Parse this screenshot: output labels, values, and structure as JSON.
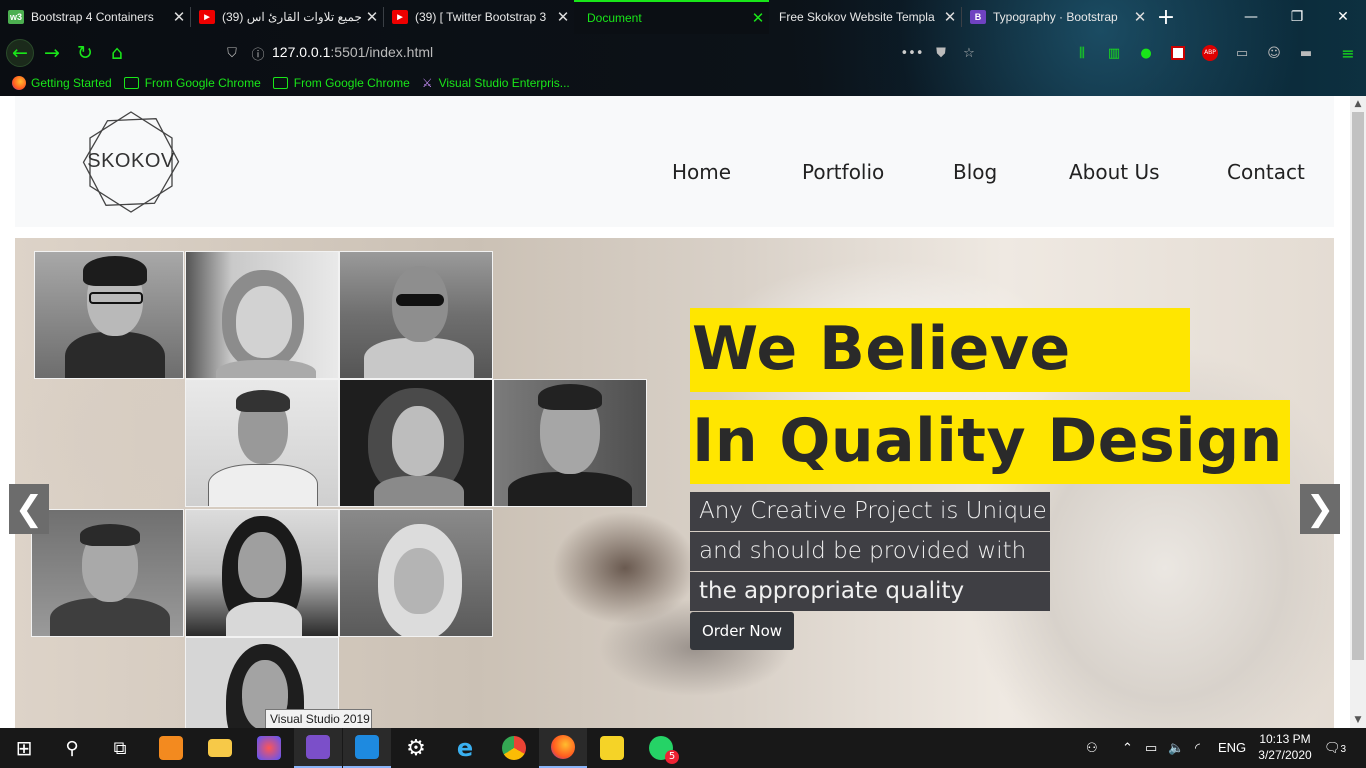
{
  "browser": {
    "tabs": [
      {
        "label": "Bootstrap 4 Containers",
        "icon": "w3-icon"
      },
      {
        "label": "(39) جميع تلاوات القارئ اس",
        "icon": "youtube-icon"
      },
      {
        "label": "(39) [ Twitter Bootstrap 3",
        "icon": "youtube-icon"
      },
      {
        "label": "Document",
        "icon": ""
      },
      {
        "label": "Free Skokov Website Templa",
        "icon": ""
      },
      {
        "label": "Typography · Bootstrap",
        "icon": "bootstrap-icon"
      }
    ],
    "url_host": "127.0.0.1",
    "url_rest": ":5501/index.html",
    "bookmarks": [
      "Getting Started",
      "From Google Chrome",
      "From Google Chrome",
      "Visual Studio Enterpris..."
    ],
    "accent": "#19e619"
  },
  "site": {
    "logo_text": "SKOKOV",
    "nav": [
      "Home",
      "Portfolio",
      "Blog",
      "About Us",
      "Contact"
    ]
  },
  "hero": {
    "title_line1": "We Believe",
    "title_line2": "In Quality Design",
    "sub_line1": "Any Creative Project is Unique",
    "sub_line2": "and should be provided with",
    "sub_line3": "the appropriate quality",
    "button": "Order Now",
    "highlight_color": "#ffe600"
  },
  "tooltip": "Visual Studio 2019",
  "taskbar": {
    "language": "ENG",
    "time": "10:13 PM",
    "date": "3/27/2020",
    "whatsapp_badge": "5",
    "notification_count": "3"
  }
}
